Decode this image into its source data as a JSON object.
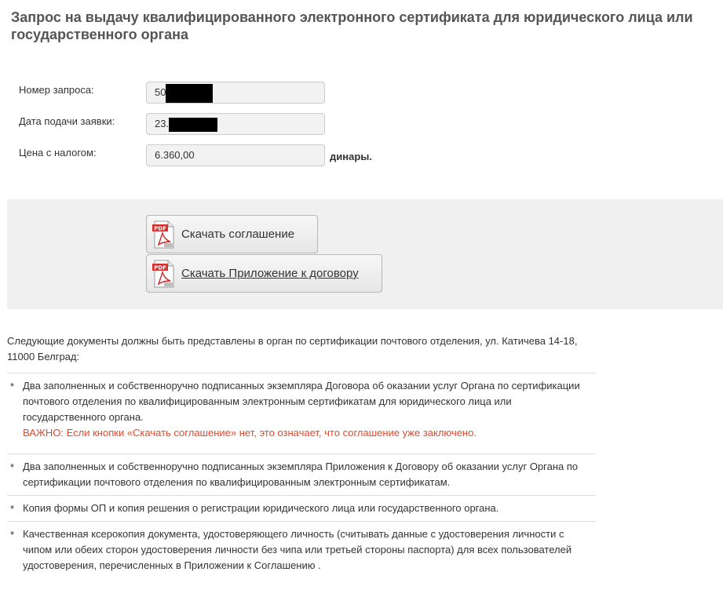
{
  "page": {
    "title": "Запрос на выдачу квалифицированного электронного сертификата для юридического лица или государственного органа"
  },
  "request": {
    "number_label": "Номер запроса:",
    "number_value": "50",
    "date_label": "Дата подачи заявки:",
    "date_value": "23.",
    "price_label": "Цена с налогом:",
    "price_value": "6.360,00",
    "currency": "динары."
  },
  "downloads": {
    "agreement_label": "Скачать соглашение",
    "appendix_label": "Скачать Приложение к договору",
    "icon": "pdf-document-icon"
  },
  "documents": {
    "intro": "Следующие документы должны быть представлены в орган по сертификации почтового отделения, ул. Катичева 14-18, 11000 Белград:",
    "bullet": "*",
    "items": [
      {
        "text": "Два заполненных и собственноручно подписанных экземпляра Договора об оказании услуг Органа по сертификации почтового отделения по квалифицированным электронным сертификатам для юридического лица или государственного органа.",
        "warning": "ВАЖНО: Если кнопки «Скачать соглашение» нет, это означает, что соглашение уже заключено."
      },
      {
        "text": "Два заполненных и собственноручно подписанных экземпляра Приложения к Договору об оказании услуг Органа по сертификации почтового отделения по квалифицированным электронным сертификатам."
      },
      {
        "text": "Копия формы ОП и копия решения о регистрации юридического лица или государственного органа."
      },
      {
        "text": "Качественная ксерокопия документа, удостоверяющего личность (считывать данные с удостоверения личности с чипом или обеих сторон удостоверения личности без чипа или третьей стороны паспорта) для всех пользователей удостоверения, перечисленных в Приложении к Соглашению ."
      }
    ]
  },
  "colors": {
    "title": "#555555",
    "warning": "#e04a2f",
    "panel": "#f0f0f0",
    "field": "#f2f2f2"
  }
}
